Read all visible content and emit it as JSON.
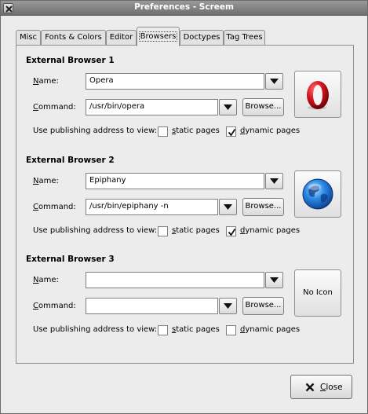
{
  "window": {
    "title": "Preferences - Screem"
  },
  "tabs": [
    {
      "label": "Misc"
    },
    {
      "label": "Fonts & Colors"
    },
    {
      "label": "Editor"
    },
    {
      "label": "Browsers"
    },
    {
      "label": "Doctypes"
    },
    {
      "label": "Tag Trees"
    }
  ],
  "active_tab": "Browsers",
  "labels": {
    "name": "Name:",
    "name_first": "N",
    "name_rest": "ame:",
    "command_first": "C",
    "command_rest": "ommand:",
    "use_publishing": "Use publishing address to view:",
    "static_first": "s",
    "static_rest": "tatic pages",
    "dynamic_first": "d",
    "dynamic_rest": "ynamic pages",
    "browse": "Browse...",
    "no_icon": "No Icon"
  },
  "browsers": [
    {
      "title": "External Browser 1",
      "name": "Opera",
      "command": "/usr/bin/opera",
      "static_pages": false,
      "dynamic_pages": true,
      "icon": "opera-icon"
    },
    {
      "title": "External Browser 2",
      "name": "Epiphany",
      "command": "/usr/bin/epiphany -n",
      "static_pages": false,
      "dynamic_pages": true,
      "icon": "epiphany-globe-icon"
    },
    {
      "title": "External Browser 3",
      "name": "",
      "command": "",
      "static_pages": false,
      "dynamic_pages": false,
      "icon": "no-icon"
    }
  ],
  "footer": {
    "close_first": "C",
    "close_rest": "lose"
  },
  "colors": {
    "titlebar": "#7f7f7f",
    "opera_red": "#c8101a",
    "globe_blue": "#1e6fd0"
  }
}
